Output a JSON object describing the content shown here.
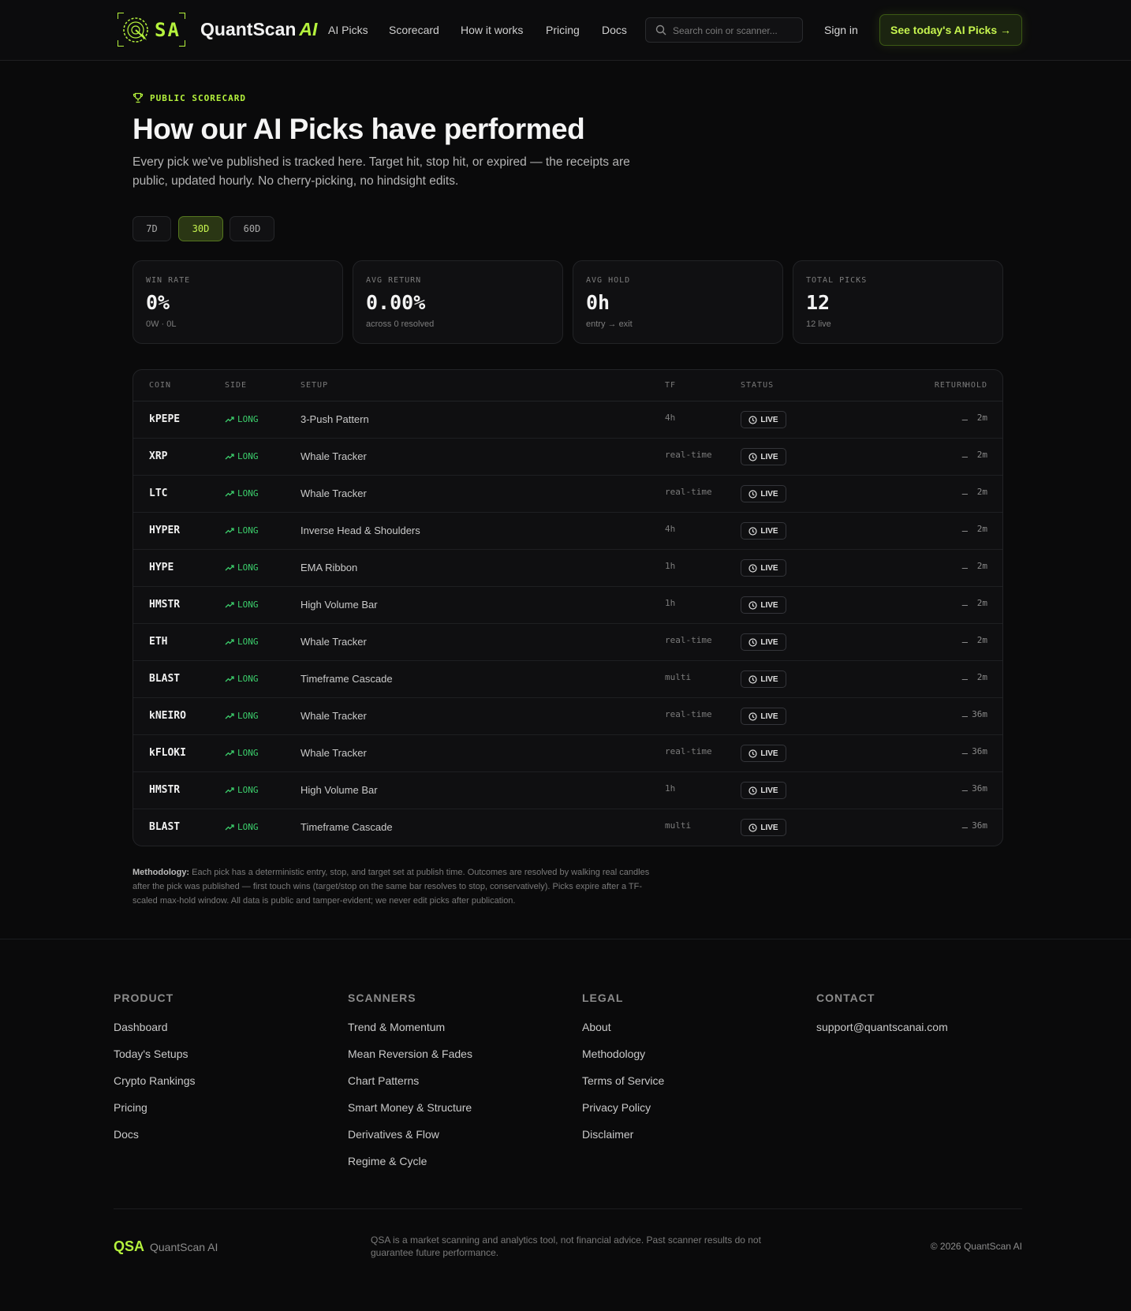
{
  "header": {
    "logo_mark": "SA",
    "brand": "QuantScan",
    "brand_suffix": "AI",
    "nav": [
      "AI Picks",
      "Scorecard",
      "How it works",
      "Pricing",
      "Docs"
    ],
    "search_placeholder": "Search coin or scanner...",
    "signin": "Sign in",
    "cta": "See today's AI Picks →"
  },
  "hero": {
    "eyebrow": "PUBLIC SCORECARD",
    "title": "How our AI Picks have performed",
    "subtitle": "Every pick we've published is tracked here. Target hit, stop hit, or expired — the receipts are public, updated hourly. No cherry-picking, no hindsight edits."
  },
  "periods": {
    "options": [
      "7D",
      "30D",
      "60D"
    ],
    "selected": "30D"
  },
  "stats": [
    {
      "label": "WIN RATE",
      "value": "0%",
      "sub": "0W · 0L"
    },
    {
      "label": "AVG RETURN",
      "value": "0.00%",
      "sub": "across 0 resolved"
    },
    {
      "label": "AVG HOLD",
      "value": "0h",
      "sub": "entry → exit"
    },
    {
      "label": "TOTAL PICKS",
      "value": "12",
      "sub": "12 live"
    }
  ],
  "table": {
    "headers": {
      "coin": "COIN",
      "side": "SIDE",
      "setup": "SETUP",
      "tf": "TF",
      "status": "STATUS",
      "return": "RETURN",
      "hold": "HOLD"
    },
    "rows": [
      {
        "coin": "kPEPE",
        "side": "LONG",
        "setup": "3-Push Pattern",
        "tf": "4h",
        "status": "LIVE",
        "return": "–",
        "hold": "2m"
      },
      {
        "coin": "XRP",
        "side": "LONG",
        "setup": "Whale Tracker",
        "tf": "real-time",
        "status": "LIVE",
        "return": "–",
        "hold": "2m"
      },
      {
        "coin": "LTC",
        "side": "LONG",
        "setup": "Whale Tracker",
        "tf": "real-time",
        "status": "LIVE",
        "return": "–",
        "hold": "2m"
      },
      {
        "coin": "HYPER",
        "side": "LONG",
        "setup": "Inverse Head & Shoulders",
        "tf": "4h",
        "status": "LIVE",
        "return": "–",
        "hold": "2m"
      },
      {
        "coin": "HYPE",
        "side": "LONG",
        "setup": "EMA Ribbon",
        "tf": "1h",
        "status": "LIVE",
        "return": "–",
        "hold": "2m"
      },
      {
        "coin": "HMSTR",
        "side": "LONG",
        "setup": "High Volume Bar",
        "tf": "1h",
        "status": "LIVE",
        "return": "–",
        "hold": "2m"
      },
      {
        "coin": "ETH",
        "side": "LONG",
        "setup": "Whale Tracker",
        "tf": "real-time",
        "status": "LIVE",
        "return": "–",
        "hold": "2m"
      },
      {
        "coin": "BLAST",
        "side": "LONG",
        "setup": "Timeframe Cascade",
        "tf": "multi",
        "status": "LIVE",
        "return": "–",
        "hold": "2m"
      },
      {
        "coin": "kNEIRO",
        "side": "LONG",
        "setup": "Whale Tracker",
        "tf": "real-time",
        "status": "LIVE",
        "return": "–",
        "hold": "36m"
      },
      {
        "coin": "kFLOKI",
        "side": "LONG",
        "setup": "Whale Tracker",
        "tf": "real-time",
        "status": "LIVE",
        "return": "–",
        "hold": "36m"
      },
      {
        "coin": "HMSTR",
        "side": "LONG",
        "setup": "High Volume Bar",
        "tf": "1h",
        "status": "LIVE",
        "return": "–",
        "hold": "36m"
      },
      {
        "coin": "BLAST",
        "side": "LONG",
        "setup": "Timeframe Cascade",
        "tf": "multi",
        "status": "LIVE",
        "return": "–",
        "hold": "36m"
      }
    ]
  },
  "methodology": {
    "label": "Methodology:",
    "text": " Each pick has a deterministic entry, stop, and target set at publish time. Outcomes are resolved by walking real candles after the pick was published — first touch wins (target/stop on the same bar resolves to stop, conservatively). Picks expire after a TF-scaled max-hold window. All data is public and tamper-evident; we never edit picks after publication."
  },
  "footer": {
    "columns": [
      {
        "heading": "PRODUCT",
        "links": [
          "Dashboard",
          "Today's Setups",
          "Crypto Rankings",
          "Pricing",
          "Docs"
        ]
      },
      {
        "heading": "SCANNERS",
        "links": [
          "Trend & Momentum",
          "Mean Reversion & Fades",
          "Chart Patterns",
          "Smart Money & Structure",
          "Derivatives & Flow",
          "Regime & Cycle"
        ]
      },
      {
        "heading": "LEGAL",
        "links": [
          "About",
          "Methodology",
          "Terms of Service",
          "Privacy Policy",
          "Disclaimer"
        ]
      },
      {
        "heading": "CONTACT",
        "links": [
          "support@quantscanai.com"
        ]
      }
    ],
    "brand_mark": "QSA",
    "brand_name": "QuantScan AI",
    "disclaimer": "QSA is a market scanning and analytics tool, not financial advice. Past scanner results do not guarantee future performance.",
    "copyright": "© 2026 QuantScan AI"
  },
  "colors": {
    "accent": "#b5f23d",
    "long": "#3ccf6c",
    "background": "#0a0a0b"
  },
  "icons": {
    "eyebrow": "trophy-icon",
    "search": "search-icon",
    "side": "trend-up-icon",
    "status": "clock-icon",
    "logo": "radar-icon"
  }
}
